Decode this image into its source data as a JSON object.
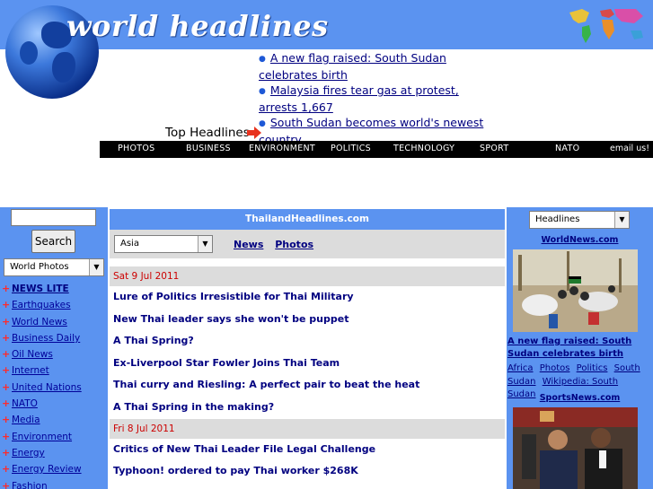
{
  "header": {
    "logo_text": "world headlines",
    "top_headlines_label": "Top Headlines",
    "headlines": [
      "A new flag raised: South Sudan celebrates birth",
      "Malaysia fires tear gas at protest, arrests 1,667",
      "South Sudan becomes world's newest country"
    ]
  },
  "nav": {
    "items": [
      "PHOTOS",
      "BUSINESS",
      "ENVIRONMENT",
      "POLITICS",
      "TECHNOLOGY",
      "SPORT",
      "NATO",
      "email us!"
    ]
  },
  "left": {
    "search_placeholder": "",
    "search_button": "Search",
    "select_value": "World Photos",
    "items": [
      {
        "label": "NEWS LITE",
        "bold": true
      },
      {
        "label": "Earthquakes"
      },
      {
        "label": "World News"
      },
      {
        "label": "Business Daily"
      },
      {
        "label": "Oil News"
      },
      {
        "label": "Internet"
      },
      {
        "label": "United Nations"
      },
      {
        "label": "NATO"
      },
      {
        "label": "Media"
      },
      {
        "label": "Environment"
      },
      {
        "label": "Energy"
      },
      {
        "label": "Energy Review"
      },
      {
        "label": "Fashion"
      }
    ],
    "bullet": "+"
  },
  "center": {
    "title": "ThailandHeadlines.com",
    "region_select": "Asia",
    "tabs": [
      "News",
      "Photos"
    ],
    "dates": [
      "Sat 9 Jul 2011",
      "Fri 8 Jul 2011"
    ],
    "news_group1": [
      "Lure of Politics Irresistible for Thai Military",
      "New Thai leader says she won't be puppet",
      "A Thai Spring?",
      "Ex-Liverpool Star Fowler Joins Thai Team",
      "Thai curry and Riesling: A perfect pair to beat the heat",
      "A Thai Spring in the making?"
    ],
    "news_group2": [
      "Critics of New Thai Leader File Legal Challenge",
      "Typhoon! ordered to pay Thai worker $268K"
    ]
  },
  "right": {
    "select_value": "Headlines",
    "site1": "WorldNews.com",
    "caption": "A new flag raised: South Sudan celebrates birth",
    "tags": [
      "Africa",
      "Photos",
      "Politics",
      "South Sudan",
      "Wikipedia: South Sudan"
    ],
    "site2": "SportsNews.com"
  },
  "colors": {
    "accent_blue": "#5b93f0",
    "link_navy": "#000080",
    "date_red": "#cc0000",
    "nav_black": "#000000"
  }
}
